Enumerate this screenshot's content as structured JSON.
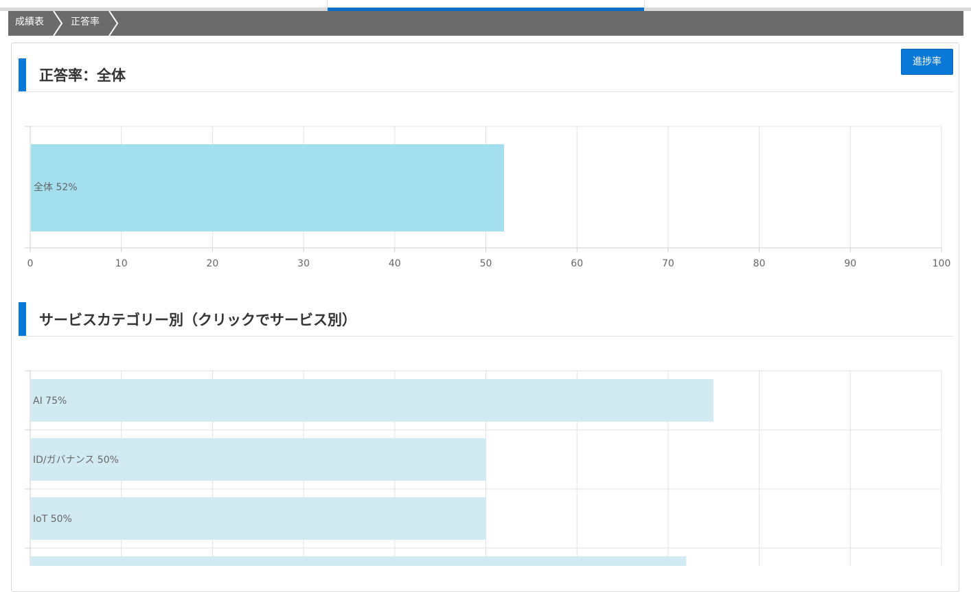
{
  "breadcrumb": {
    "items": [
      {
        "label": "成績表"
      },
      {
        "label": "正答率"
      }
    ]
  },
  "header": {
    "progress_button_label": "進捗率"
  },
  "sections": {
    "overall": {
      "title": "正答率：全体"
    },
    "category": {
      "title": "サービスカテゴリー別（クリックでサービス別）"
    }
  },
  "colors": {
    "accent": "#0a78d7",
    "breadcrumb_bg": "#6b6b6b",
    "overall_bar": "#a3dfef",
    "category_bar": "#d2eaf2",
    "bar_label": "#666666"
  },
  "chart_data": [
    {
      "type": "bar",
      "orientation": "horizontal",
      "categories": [
        "全体"
      ],
      "values": [
        52
      ],
      "bar_labels": [
        "全体 52%"
      ],
      "xlim": [
        0,
        100
      ],
      "xticks": [
        "0",
        "10",
        "20",
        "30",
        "40",
        "50",
        "60",
        "70",
        "80",
        "90",
        "100"
      ],
      "grid": true
    },
    {
      "type": "bar",
      "orientation": "horizontal",
      "categories": [
        "AI",
        "ID/ガバナンス",
        "IoT",
        ""
      ],
      "values": [
        75,
        50,
        50,
        72
      ],
      "bar_labels": [
        "AI 75%",
        "ID/ガバナンス 50%",
        "IoT 50%",
        ""
      ],
      "xlim": [
        0,
        100
      ],
      "grid": true
    }
  ]
}
